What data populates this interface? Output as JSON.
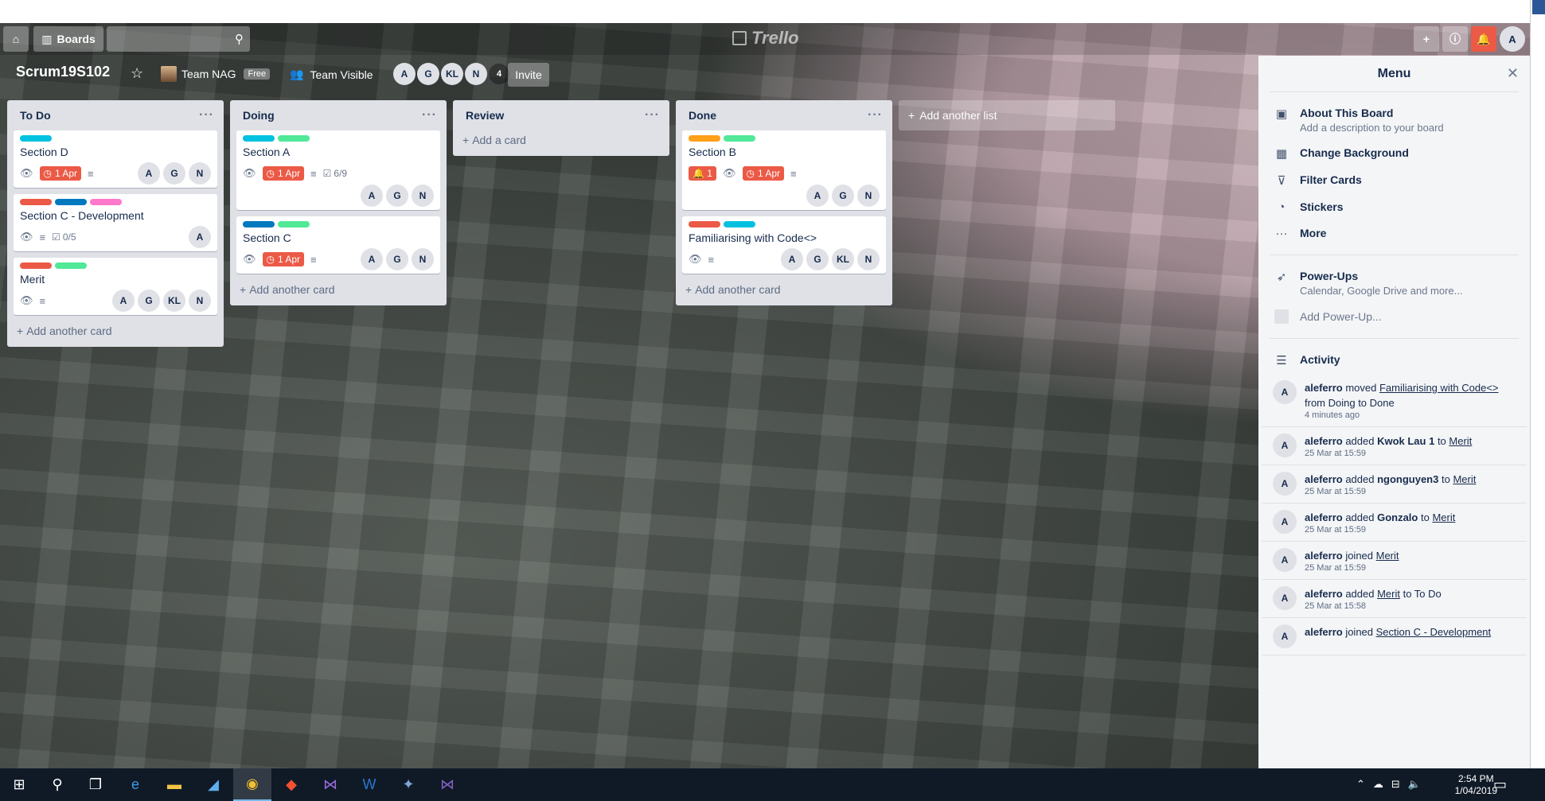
{
  "header": {
    "boards_label": "Boards",
    "logo_text": "Trello",
    "user_initial": "A"
  },
  "board": {
    "title": "Scrum19S102",
    "team_name": "Team NAG",
    "team_badge": "Free",
    "visibility": "Team Visible",
    "members": [
      "A",
      "G",
      "KL",
      "N"
    ],
    "member_count": "4",
    "invite_label": "Invite"
  },
  "lists": [
    {
      "title": "To Do",
      "add_label": "Add another card",
      "cards": [
        {
          "title": "Section D",
          "labels": [
            "cyan"
          ],
          "due": "1 Apr",
          "members": [
            "A",
            "G",
            "N"
          ]
        },
        {
          "title": "Section C - Development",
          "labels": [
            "red",
            "blue",
            "pink"
          ],
          "checklist": "0/5",
          "members": [
            "A"
          ]
        },
        {
          "title": "Merit",
          "labels": [
            "red",
            "mint"
          ],
          "members": [
            "A",
            "G",
            "KL",
            "N"
          ]
        }
      ]
    },
    {
      "title": "Doing",
      "add_label": "Add another card",
      "cards": [
        {
          "title": "Section A",
          "labels": [
            "cyan",
            "mint"
          ],
          "due": "1 Apr",
          "checklist": "6/9",
          "members": [
            "A",
            "G",
            "N"
          ]
        },
        {
          "title": "Section C",
          "labels": [
            "blue",
            "mint"
          ],
          "due": "1 Apr",
          "members": [
            "A",
            "G",
            "N"
          ]
        }
      ]
    },
    {
      "title": "Review",
      "add_label": "Add a card",
      "cards": []
    },
    {
      "title": "Done",
      "add_label": "Add another card",
      "cards": [
        {
          "title": "Section B",
          "labels": [
            "orange",
            "mint"
          ],
          "alerts": "1",
          "due": "1 Apr",
          "members": [
            "A",
            "G",
            "N"
          ]
        },
        {
          "title": "Familiarising with Code<>",
          "labels": [
            "red",
            "cyan"
          ],
          "members": [
            "A",
            "G",
            "KL",
            "N"
          ]
        }
      ]
    }
  ],
  "add_list_label": "Add another list",
  "menu": {
    "title": "Menu",
    "about_title": "About This Board",
    "about_sub": "Add a description to your board",
    "change_bg": "Change Background",
    "filter_cards": "Filter Cards",
    "stickers": "Stickers",
    "more": "More",
    "powerups_title": "Power-Ups",
    "powerups_sub": "Calendar, Google Drive and more...",
    "add_powerup": "Add Power-Up...",
    "activity_title": "Activity",
    "activity": [
      {
        "user": "aleferro",
        "pre": " moved ",
        "link": "Familiarising with Code<>",
        "post": " from Doing to Done",
        "time": "4 minutes ago"
      },
      {
        "user": "aleferro",
        "pre": " added ",
        "bold": "Kwok Lau 1",
        "mid": " to ",
        "link": "Merit",
        "time": "25 Mar at 15:59"
      },
      {
        "user": "aleferro",
        "pre": " added ",
        "bold": "ngonguyen3",
        "mid": " to ",
        "link": "Merit",
        "time": "25 Mar at 15:59"
      },
      {
        "user": "aleferro",
        "pre": " added ",
        "bold": "Gonzalo",
        "mid": " to ",
        "link": "Merit",
        "time": "25 Mar at 15:59"
      },
      {
        "user": "aleferro",
        "pre": " joined ",
        "link": "Merit",
        "time": "25 Mar at 15:59"
      },
      {
        "user": "aleferro",
        "pre": " added ",
        "link": "Merit",
        "post": " to To Do",
        "time": "25 Mar at 15:58"
      },
      {
        "user": "aleferro",
        "pre": " joined ",
        "link": "Section C - Development",
        "time": ""
      }
    ]
  },
  "taskbar": {
    "time": "2:54 PM",
    "date": "1/04/2019"
  },
  "colors": {
    "due_red": "#eb5a46",
    "list_bg": "#dfe1e6",
    "label_cyan": "#00c2e0",
    "label_mint": "#51e898",
    "label_red": "#eb5a46",
    "label_blue": "#0079bf",
    "label_pink": "#ff78cb",
    "label_orange": "#ff9f1a"
  }
}
